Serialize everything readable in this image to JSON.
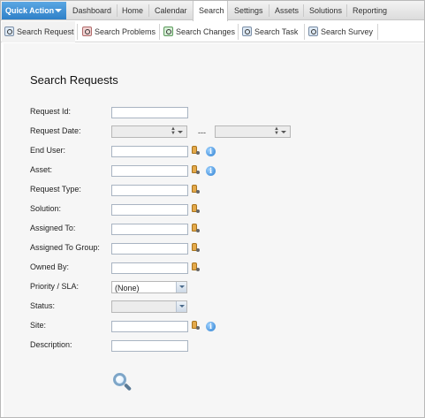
{
  "nav": {
    "quick_action": "Quick Action",
    "items": [
      "Dashboard",
      "Home",
      "Calendar",
      "Search",
      "Settings",
      "Assets",
      "Solutions",
      "Reporting"
    ],
    "active": "Search"
  },
  "subnav": {
    "tabs": [
      {
        "label": "Search Request",
        "icon": "search-request-icon"
      },
      {
        "label": "Search Problems",
        "icon": "search-problems-icon"
      },
      {
        "label": "Search Changes",
        "icon": "search-changes-icon"
      },
      {
        "label": "Search Task",
        "icon": "search-task-icon"
      },
      {
        "label": "Search Survey",
        "icon": "search-survey-icon"
      }
    ],
    "active": "Search Request"
  },
  "form": {
    "title": "Search Requests",
    "labels": {
      "request_id": "Request Id:",
      "request_date": "Request Date:",
      "end_user": "End User:",
      "asset": "Asset:",
      "request_type": "Request Type:",
      "solution": "Solution:",
      "assigned_to": "Assigned To:",
      "assigned_to_group": "Assigned To Group:",
      "owned_by": "Owned By:",
      "priority_sla": "Priority / SLA:",
      "status": "Status:",
      "site": "Site:",
      "description": "Description:"
    },
    "date_separator": "---",
    "priority_value": "(None)",
    "status_value": ""
  }
}
